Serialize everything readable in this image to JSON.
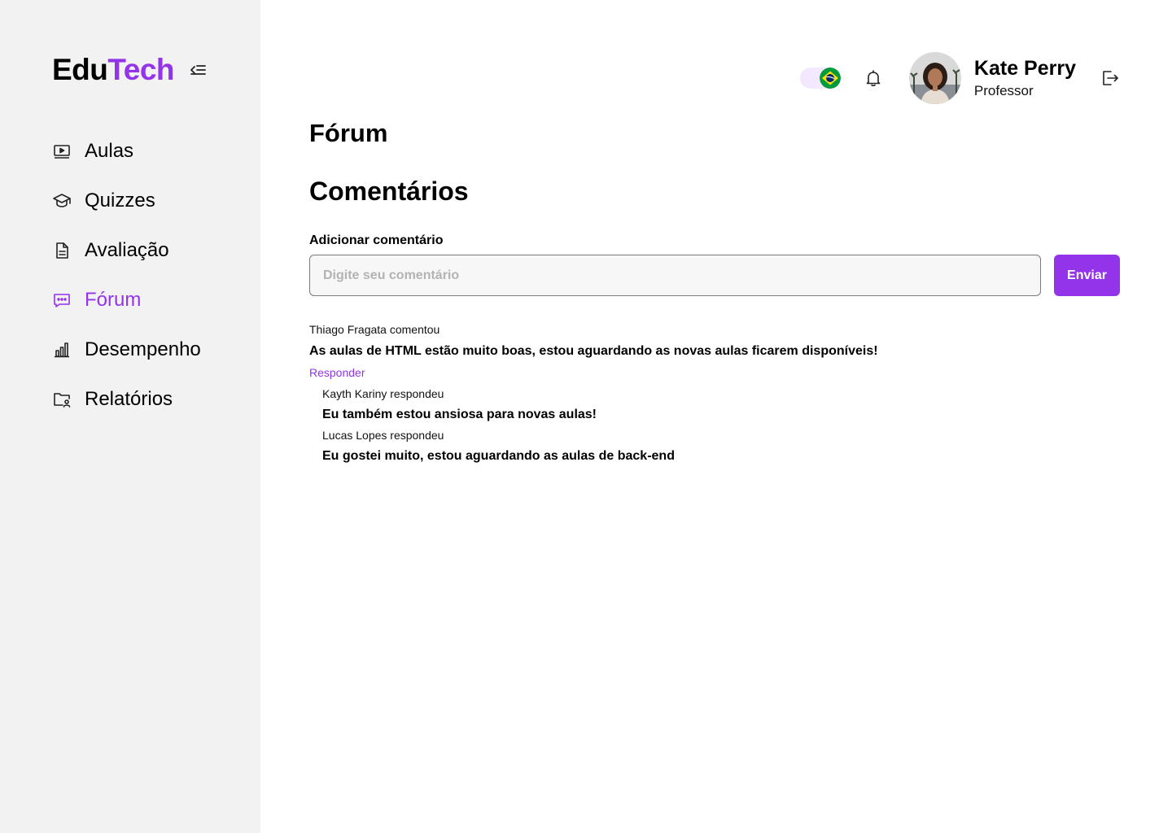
{
  "brand": {
    "part1": "Edu",
    "part2": "Tech",
    "accent_color": "#9333ea"
  },
  "sidebar": {
    "items": [
      {
        "label": "Aulas",
        "icon": "video-lesson-icon",
        "active": false
      },
      {
        "label": "Quizzes",
        "icon": "graduation-cap-icon",
        "active": false
      },
      {
        "label": "Avaliação",
        "icon": "document-icon",
        "active": false
      },
      {
        "label": "Fórum",
        "icon": "chat-bubble-icon",
        "active": true
      },
      {
        "label": "Desempenho",
        "icon": "bar-chart-icon",
        "active": false
      },
      {
        "label": "Relatórios",
        "icon": "folder-user-icon",
        "active": false
      }
    ]
  },
  "header": {
    "language": "pt-BR",
    "user": {
      "name": "Kate Perry",
      "role": "Professor"
    }
  },
  "page": {
    "title": "Fórum",
    "section_title": "Comentários",
    "form": {
      "label": "Adicionar comentário",
      "placeholder": "Digite seu comentário",
      "value": "",
      "submit_label": "Enviar"
    }
  },
  "comments": [
    {
      "author_line": "Thiago Fragata comentou",
      "text": "As aulas de HTML estão muito boas, estou aguardando as novas aulas ficarem disponíveis!",
      "reply_label": "Responder",
      "replies": [
        {
          "author_line": "Kayth Kariny respondeu",
          "text": "Eu também estou ansiosa para novas aulas!"
        },
        {
          "author_line": "Lucas Lopes respondeu",
          "text": "Eu gostei muito, estou aguardando as aulas de back-end"
        }
      ]
    }
  ]
}
